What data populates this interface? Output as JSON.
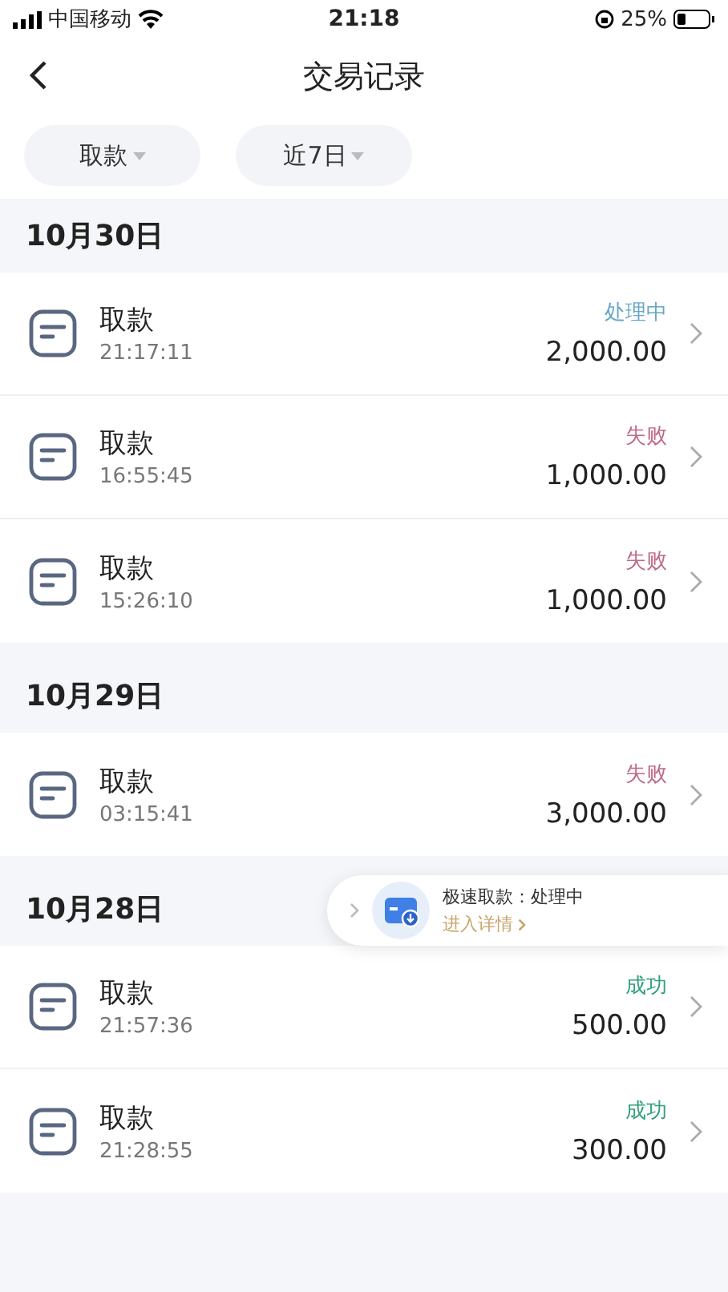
{
  "status_bar": {
    "carrier": "中国移动",
    "time": "21:18",
    "battery": "25%"
  },
  "nav": {
    "title": "交易记录"
  },
  "filters": [
    {
      "label": "取款"
    },
    {
      "label": "近7日"
    }
  ],
  "sections": [
    {
      "date": "10月30日",
      "rows": [
        {
          "title": "取款",
          "time": "21:17:11",
          "status": "处理中",
          "kind": "processing",
          "amount": "2,000.00"
        },
        {
          "title": "取款",
          "time": "16:55:45",
          "status": "失败",
          "kind": "failed",
          "amount": "1,000.00"
        },
        {
          "title": "取款",
          "time": "15:26:10",
          "status": "失败",
          "kind": "failed",
          "amount": "1,000.00"
        }
      ]
    },
    {
      "date": "10月29日",
      "rows": [
        {
          "title": "取款",
          "time": "03:15:41",
          "status": "失败",
          "kind": "failed",
          "amount": "3,000.00"
        }
      ]
    },
    {
      "date": "10月28日",
      "rows": [
        {
          "title": "取款",
          "time": "21:57:36",
          "status": "成功",
          "kind": "success",
          "amount": "500.00"
        },
        {
          "title": "取款",
          "time": "21:28:55",
          "status": "成功",
          "kind": "success",
          "amount": "300.00"
        }
      ]
    }
  ],
  "floating_banner": {
    "title": "极速取款：处理中",
    "link": "进入详情"
  }
}
